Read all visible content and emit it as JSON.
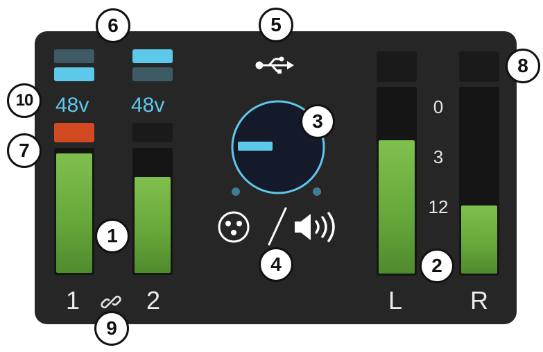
{
  "colors": {
    "panel": "#262626",
    "phantom_on": "#5ec8eb",
    "phantom_off": "#3e5a64",
    "clip_red": "#d24a22",
    "meter_green": "#6aab3f",
    "knob_ring": "#5ec8eb"
  },
  "inputs": [
    {
      "label": "1",
      "phantom_label": "48v",
      "top_led": "off",
      "bottom_led": "on",
      "clip": true,
      "level": 0.97
    },
    {
      "label": "2",
      "phantom_label": "48v",
      "top_led": "on",
      "bottom_led": "off",
      "clip": false,
      "level": 0.78
    }
  ],
  "link_icon": "link-icon",
  "usb_icon": "usb-icon",
  "monitor": {
    "knob_indicator": "horizontal-bar",
    "mic_icon": "xlr-connector-icon",
    "separator": "/",
    "speaker_icon": "speaker-icon"
  },
  "outputs": [
    {
      "label": "L",
      "level": 0.72,
      "clip": false
    },
    {
      "label": "R",
      "level": 0.37,
      "clip": false
    }
  ],
  "scale_labels": [
    "0",
    "3",
    "12"
  ],
  "callouts": [
    "1",
    "2",
    "3",
    "4",
    "5",
    "6",
    "7",
    "8",
    "9",
    "10"
  ]
}
